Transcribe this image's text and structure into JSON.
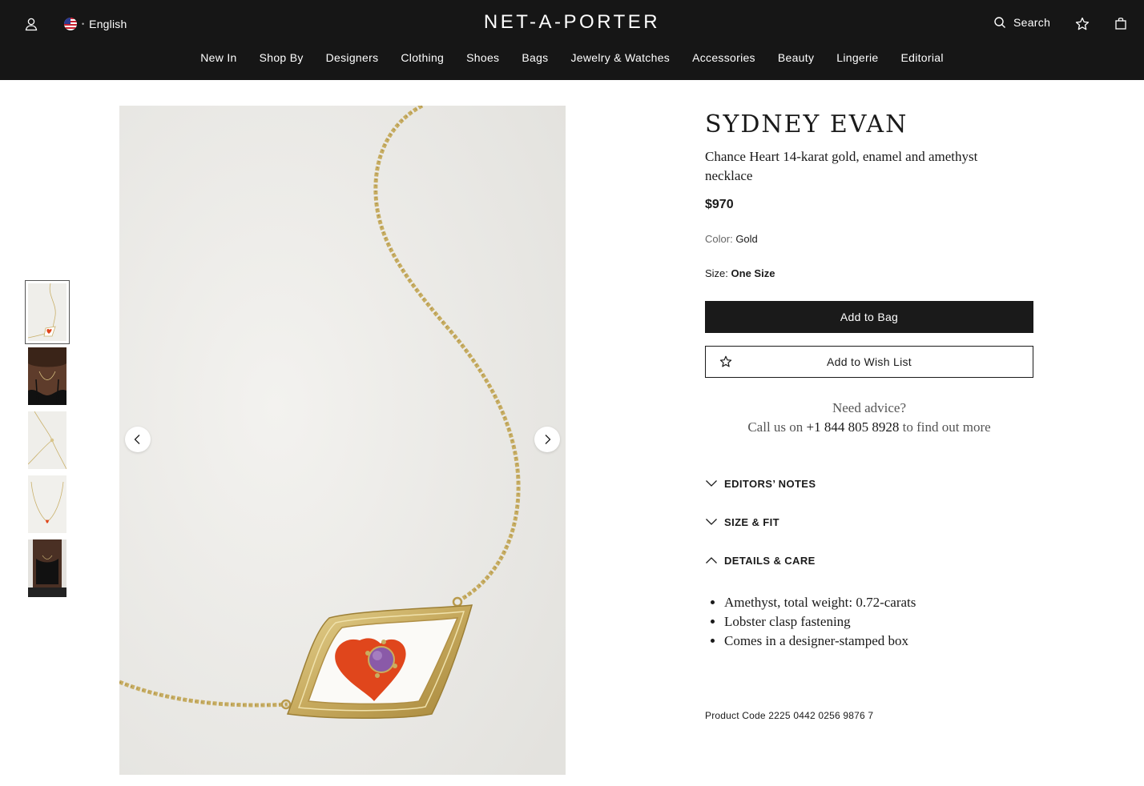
{
  "header": {
    "language": "English",
    "logo": "NET-A-PORTER",
    "search_label": "Search",
    "icons": [
      "account-icon",
      "us-flag-icon",
      "search-icon",
      "wish-list-icon",
      "shopping-bag-icon"
    ]
  },
  "nav": {
    "items": [
      "New In",
      "Shop By",
      "Designers",
      "Clothing",
      "Shoes",
      "Bags",
      "Jewelry & Watches",
      "Accessories",
      "Beauty",
      "Lingerie",
      "Editorial"
    ]
  },
  "gallery": {
    "thumbnail_count": 5,
    "active_index": 0,
    "icons": [
      "chevron-left-icon",
      "chevron-right-icon"
    ]
  },
  "product": {
    "designer": "SYDNEY EVAN",
    "name": "Chance Heart 14-karat gold, enamel and amethyst necklace",
    "price": "$970",
    "color_label": "Color:",
    "color_value": "Gold",
    "size_label": "Size:",
    "size_value": "One Size",
    "add_to_bag": "Add to Bag",
    "add_to_wish_list": "Add to Wish List",
    "advice_title": "Need advice?",
    "advice_prefix": "Call us on",
    "advice_phone": "+1 844 805 8928",
    "advice_suffix": "to find out more",
    "accordion": {
      "editors_notes": "EDITORS’ NOTES",
      "size_fit": "SIZE & FIT",
      "details_care": "DETAILS & CARE"
    },
    "details": [
      "Amethyst, total weight: 0.72-carats",
      "Lobster clasp fastening",
      "Comes in a designer-stamped box"
    ],
    "product_code": "Product Code 2225 0442 0256 9876 7"
  },
  "colors": {
    "header_bg": "#161616",
    "gold": "#c9b06a",
    "enamel_red": "#e0461c",
    "amethyst": "#8a5aa8"
  }
}
